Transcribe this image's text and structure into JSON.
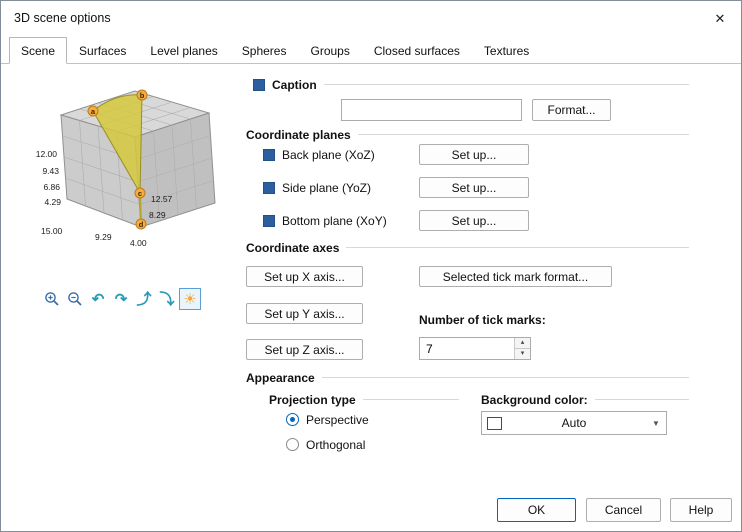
{
  "window": {
    "title": "3D scene options",
    "close_glyph": "✕"
  },
  "tabs": [
    {
      "label": "Scene",
      "active": true
    },
    {
      "label": "Surfaces",
      "active": false
    },
    {
      "label": "Level planes",
      "active": false
    },
    {
      "label": "Spheres",
      "active": false
    },
    {
      "label": "Groups",
      "active": false
    },
    {
      "label": "Closed surfaces",
      "active": false
    },
    {
      "label": "Textures",
      "active": false
    }
  ],
  "preview": {
    "z_ticks": [
      "12.00",
      "9.43",
      "6.86",
      "4.29"
    ],
    "bottom_ticks": [
      "15.00",
      "9.29",
      "4.00"
    ],
    "right_ticks": [
      "12.57",
      "8.29"
    ],
    "points": [
      "a",
      "b",
      "c",
      "d"
    ],
    "toolbar": {
      "rotate_left_glyph": "↶",
      "rotate_right_glyph": "↷",
      "tilt_up_glyph": "⤴",
      "tilt_down_glyph": "⤵",
      "light_glyph": "☀"
    }
  },
  "caption": {
    "label": "Caption",
    "checked": true,
    "text_value": "",
    "format_button": "Format..."
  },
  "coordinate_planes": {
    "label": "Coordinate planes",
    "items": [
      {
        "label": "Back plane (XoZ)",
        "checked": true,
        "button": "Set up..."
      },
      {
        "label": "Side plane (YoZ)",
        "checked": true,
        "button": "Set up..."
      },
      {
        "label": "Bottom plane (XoY)",
        "checked": true,
        "button": "Set up..."
      }
    ]
  },
  "coordinate_axes": {
    "label": "Coordinate axes",
    "setup_x_button": "Set up X axis...",
    "setup_y_button": "Set up Y axis...",
    "setup_z_button": "Set up Z axis...",
    "tick_format_button": "Selected tick mark format...",
    "tick_marks_label": "Number of tick marks:",
    "tick_marks_value": "7"
  },
  "appearance": {
    "label": "Appearance",
    "projection": {
      "label": "Projection type",
      "options": [
        {
          "label": "Perspective",
          "selected": true
        },
        {
          "label": "Orthogonal",
          "selected": false
        }
      ]
    },
    "background": {
      "label": "Background color:",
      "value": "Auto",
      "swatch_color": "#ffffff"
    }
  },
  "footer": {
    "ok": "OK",
    "cancel": "Cancel",
    "help": "Help"
  },
  "glyphs": {
    "spin_up": "▴",
    "spin_down": "▾",
    "dropdown_arrow": "▼"
  },
  "colors": {
    "checkbox": "#2d5f9f",
    "accent": "#0067c0",
    "toolbar_arrow": "#2a9bb5",
    "sun": "#f0a83c",
    "cone": "#d5c93d",
    "point_marker": "#f6ab3c"
  }
}
